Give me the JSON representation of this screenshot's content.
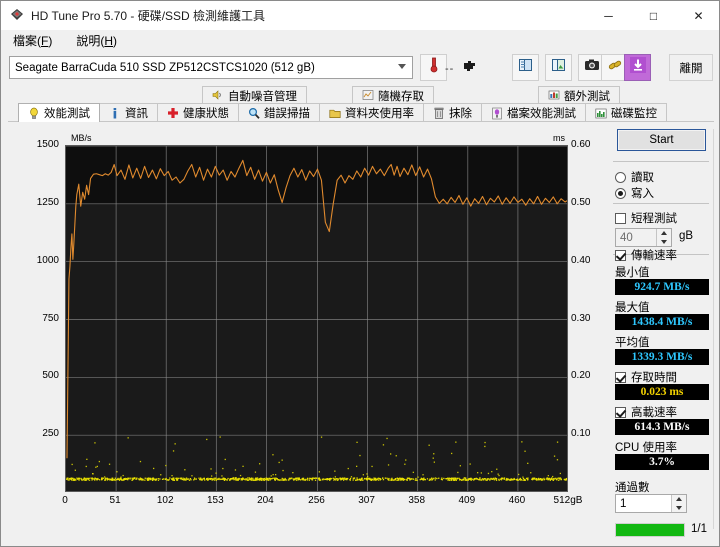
{
  "window": {
    "title": "HD Tune Pro 5.70 - 硬碟/SSD 檢測維護工具",
    "app_icon": "hdtune-logo-icon",
    "minimize_label": "─",
    "maximize_label": "□",
    "close_label": "✕"
  },
  "menubar": {
    "items": [
      {
        "label": "檔案",
        "accel": "F"
      },
      {
        "label": "說明",
        "accel": "H"
      }
    ]
  },
  "toolbar": {
    "drive_value": "Seagate BarraCuda 510 SSD ZP512CSTCS1020 (512 gB)",
    "temperature_value": "--",
    "buttons": [
      {
        "name": "temperature-icon",
        "label": ""
      },
      {
        "name": "plugin-icon",
        "label": ""
      },
      {
        "name": "copy-icon",
        "label": ""
      },
      {
        "name": "copy-image-icon",
        "label": ""
      },
      {
        "name": "screenshot-camera-icon",
        "label": ""
      },
      {
        "name": "link-icon",
        "label": ""
      },
      {
        "name": "download-icon",
        "label": ""
      }
    ],
    "exit_label": "離開"
  },
  "tabs": {
    "top_row": [
      {
        "label": "自動噪音管理",
        "icon": "speaker-icon"
      },
      {
        "label": "隨機存取",
        "icon": "random-access-icon"
      },
      {
        "label": "額外測試",
        "icon": "extra-test-icon"
      }
    ],
    "bottom_row": [
      {
        "label": "效能測試",
        "icon": "lightbulb-icon",
        "active": true
      },
      {
        "label": "資訊",
        "icon": "info-icon",
        "active": false
      },
      {
        "label": "健康狀態",
        "icon": "health-cross-icon",
        "active": false
      },
      {
        "label": "錯誤掃描",
        "icon": "magnifier-icon",
        "active": false
      },
      {
        "label": "資料夾使用率",
        "icon": "folder-icon",
        "active": false
      },
      {
        "label": "抹除",
        "icon": "trash-icon",
        "active": false
      },
      {
        "label": "檔案效能測試",
        "icon": "file-benchmark-icon",
        "active": false
      },
      {
        "label": "磁碟監控",
        "icon": "disk-monitor-icon",
        "active": false
      }
    ]
  },
  "panel": {
    "start_label": "Start",
    "mode_read_label": "讀取",
    "mode_write_label": "寫入",
    "mode_selected": "寫入",
    "short_stroke_label": "短程測試",
    "short_stroke_checked": false,
    "short_stroke_value": "40",
    "short_stroke_unit": "gB",
    "transfer_rate_label": "傳輸速率",
    "transfer_rate_checked": true,
    "minimum_label": "最小值",
    "minimum_value": "924.7 MB/s",
    "maximum_label": "最大值",
    "maximum_value": "1438.4 MB/s",
    "average_label": "平均值",
    "average_value": "1339.3 MB/s",
    "access_time_label": "存取時間",
    "access_time_checked": true,
    "access_time_value": "0.023 ms",
    "burst_rate_label": "高載速率",
    "burst_rate_checked": true,
    "burst_rate_value": "614.3 MB/s",
    "cpu_usage_label": "CPU 使用率",
    "cpu_usage_value": "3.7%",
    "passes_label": "通過數",
    "passes_value": "1",
    "progress_text": "1/1",
    "progress_percent": 100,
    "progress_color": "#12b812"
  },
  "chart_data": {
    "type": "line",
    "title": "",
    "xlabel": "",
    "ylabel": "MB/s",
    "y2label": "ms",
    "xlim": [
      0,
      512
    ],
    "ylim": [
      0,
      1500
    ],
    "y2lim": [
      0,
      0.6
    ],
    "grid": true,
    "x_ticks": [
      "0",
      "51",
      "102",
      "153",
      "204",
      "256",
      "307",
      "358",
      "409",
      "460",
      "512gB"
    ],
    "x_tick_values": [
      0,
      51,
      102,
      153,
      204,
      256,
      307,
      358,
      409,
      460,
      512
    ],
    "y_ticks": [
      "1500",
      "1250",
      "1000",
      "750",
      "500",
      "250"
    ],
    "y_tick_values": [
      1500,
      1250,
      1000,
      750,
      500,
      250
    ],
    "y2_ticks": [
      "0.60",
      "0.50",
      "0.40",
      "0.30",
      "0.20",
      "0.10"
    ],
    "y2_tick_values": [
      0.6,
      0.5,
      0.4,
      0.3,
      0.2,
      0.1
    ],
    "series": [
      {
        "name": "transfer-rate",
        "color": "#e08a2e",
        "axis": "left",
        "units": "MB/s",
        "x": [
          1,
          3,
          4,
          5,
          6,
          7,
          8,
          9,
          10,
          11,
          13,
          15,
          17,
          19,
          21,
          23,
          25,
          28,
          31,
          34,
          37,
          40,
          43,
          46,
          49,
          52,
          56,
          60,
          64,
          68,
          72,
          76,
          80,
          84,
          88,
          92,
          96,
          100,
          104,
          108,
          112,
          116,
          120,
          124,
          128,
          132,
          136,
          140,
          144,
          148,
          152,
          156,
          160,
          164,
          168,
          172,
          176,
          180,
          184,
          188,
          192,
          196,
          200,
          204,
          208,
          212,
          216,
          220,
          224,
          228,
          232,
          236,
          240,
          244,
          248,
          252,
          256,
          260,
          264,
          268,
          272,
          276,
          280,
          284,
          288,
          292,
          296,
          300,
          304,
          308,
          312,
          316,
          320,
          324,
          328,
          331,
          334,
          337,
          340,
          344,
          348,
          352,
          356,
          360,
          364,
          368,
          372,
          376,
          380,
          384,
          388,
          392,
          396,
          400,
          404,
          408,
          412,
          416,
          420,
          424,
          428,
          432,
          436,
          440,
          444,
          448,
          452,
          456,
          460,
          464,
          468,
          472,
          476,
          480,
          484,
          488,
          492,
          496,
          500,
          504,
          508,
          511
        ],
        "y": [
          150,
          925,
          980,
          1060,
          1120,
          1010,
          1080,
          1160,
          1240,
          1290,
          1335,
          1240,
          1300,
          1270,
          1330,
          1290,
          1360,
          1378,
          1380,
          1376,
          1372,
          1380,
          1374,
          1386,
          1420,
          1372,
          1396,
          1356,
          1418,
          1362,
          1404,
          1360,
          1412,
          1364,
          1396,
          1358,
          1402,
          1372,
          1390,
          1352,
          1366,
          1340,
          1356,
          1392,
          1420,
          1366,
          1408,
          1352,
          1400,
          1366,
          1412,
          1374,
          1396,
          1352,
          1390,
          1366,
          1404,
          1438,
          1372,
          1408,
          1356,
          1396,
          1348,
          1386,
          1340,
          1376,
          1310,
          1256,
          1320,
          1372,
          1404,
          1366,
          1398,
          1352,
          1392,
          1368,
          1400,
          1352,
          1170,
          1130,
          1250,
          1352,
          1374,
          1340,
          1372,
          1356,
          1392,
          1366,
          1404,
          1374,
          1412,
          1380,
          1400,
          1372,
          1404,
          1420,
          1374,
          1412,
          1368,
          1404,
          1376,
          1418,
          1372,
          1410,
          1366,
          1400,
          1358,
          1280,
          1252,
          1270,
          1250,
          1278,
          1256,
          1286,
          1248,
          1276,
          1240,
          1272,
          1252,
          1282,
          1246,
          1274,
          1258,
          1284,
          1248,
          1276,
          1252,
          1280,
          1256,
          1270,
          1244,
          1272,
          1250,
          1282,
          1248,
          1274,
          1256,
          1280,
          1250,
          1272,
          1258,
          1266,
          1262
        ]
      },
      {
        "name": "access-time",
        "color": "#e8e000",
        "axis": "right",
        "units": "ms",
        "baseline_ms": 0.023,
        "note": "dense yellow dot band along the baseline with sparse higher outliers up to ~0.10 ms"
      }
    ]
  }
}
